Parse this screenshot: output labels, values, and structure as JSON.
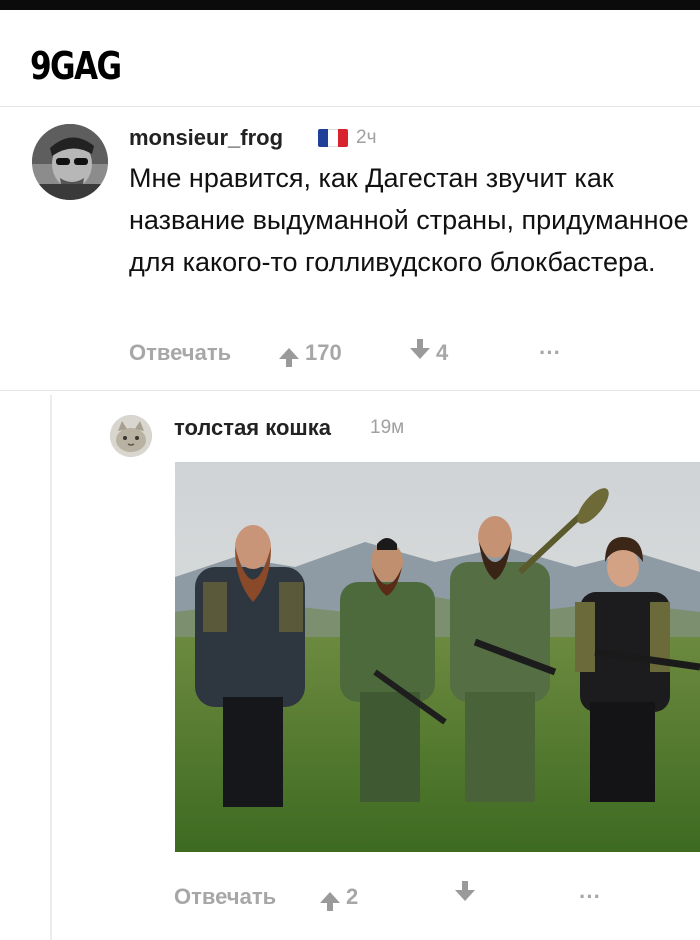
{
  "app": {
    "logo": "9GAG"
  },
  "comments": [
    {
      "username": "monsieur_frog",
      "flag_colors": [
        "#1f3f99",
        "#ffffff",
        "#d8242f"
      ],
      "time": "2ч",
      "text": "Мне нравится, как Дагестан звучит как название выдуманной страны, придуманное для какого-то голливудского блокбастера.",
      "reply_label": "Отвечать",
      "upvotes": "170",
      "downvotes": "4",
      "more_label": "···"
    },
    {
      "username": "толстая кошка",
      "time": "19м",
      "reply_label": "Отвечать",
      "upvotes": "2",
      "more_label": "···"
    }
  ],
  "colors": {
    "meta_gray": "#a7a7a7",
    "divider": "#e6e6e6"
  }
}
